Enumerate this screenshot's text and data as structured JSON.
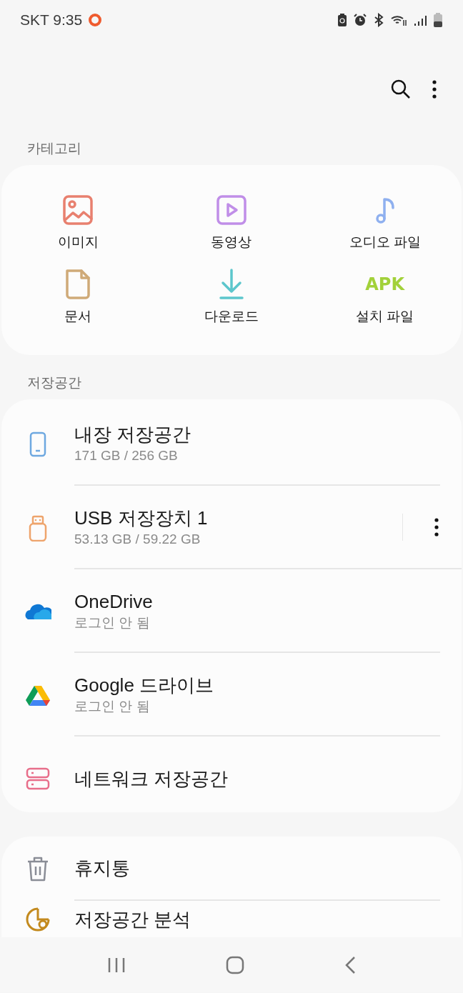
{
  "status_bar": {
    "carrier_time": "SKT 9:35"
  },
  "categories": {
    "title": "카테고리",
    "items": [
      {
        "kind": "image",
        "label": "이미지",
        "color": "#e8806f"
      },
      {
        "kind": "video",
        "label": "동영상",
        "color": "#c08ee8"
      },
      {
        "kind": "audio",
        "label": "오디오 파일",
        "color": "#8fb0ef"
      },
      {
        "kind": "document",
        "label": "문서",
        "color": "#cfaa78"
      },
      {
        "kind": "download",
        "label": "다운로드",
        "color": "#5cc6cc"
      },
      {
        "kind": "apk",
        "label": "설치 파일",
        "color": "#a2d13a",
        "icon_text": "APK"
      }
    ]
  },
  "storage": {
    "title": "저장공간",
    "items": [
      {
        "kind": "phone",
        "name": "내장 저장공간",
        "detail": "171 GB / 256 GB",
        "has_menu": false
      },
      {
        "kind": "usb",
        "name": "USB 저장장치 1",
        "detail": "53.13 GB / 59.22 GB",
        "has_menu": true
      },
      {
        "kind": "onedrive",
        "name": "OneDrive",
        "detail": "로그인 안 됨",
        "has_menu": false
      },
      {
        "kind": "gdrive",
        "name": "Google 드라이브",
        "detail": "로그인 안 됨",
        "has_menu": false
      },
      {
        "kind": "network",
        "name": "네트워크 저장공간",
        "has_menu": false
      }
    ]
  },
  "tools": {
    "items": [
      {
        "kind": "trash",
        "name": "휴지통"
      },
      {
        "kind": "analysis",
        "name": "저장공간 분석"
      }
    ]
  }
}
